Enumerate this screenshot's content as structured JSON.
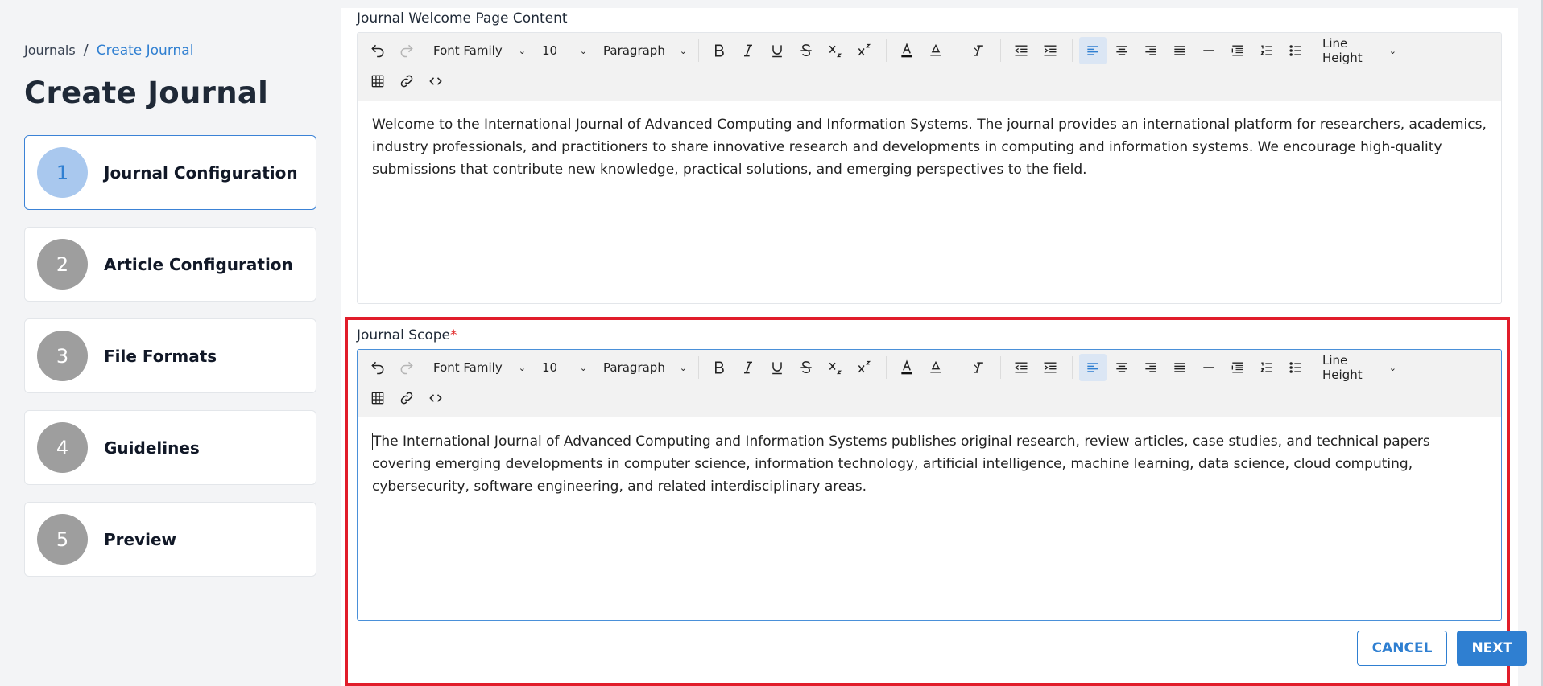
{
  "breadcrumb": {
    "root": "Journals",
    "separator": "/",
    "current": "Create Journal"
  },
  "page_title": "Create Journal",
  "steps": [
    {
      "number": "1",
      "label": "Journal Configuration",
      "active": true
    },
    {
      "number": "2",
      "label": "Article Configuration"
    },
    {
      "number": "3",
      "label": "File Formats"
    },
    {
      "number": "4",
      "label": "Guidelines"
    },
    {
      "number": "5",
      "label": "Preview"
    }
  ],
  "toolbar": {
    "font_family": "Font Family",
    "font_size": "10",
    "block_format": "Paragraph",
    "line_height": "Line Height"
  },
  "welcome": {
    "label": "Journal Welcome Page Content",
    "content": "Welcome to the International Journal of Advanced Computing and Information Systems. The journal provides an international platform for researchers, academics, industry professionals, and practitioners to share innovative research and developments in computing and information systems. We encourage high-quality submissions that contribute new knowledge, practical solutions, and emerging perspectives to the field."
  },
  "scope": {
    "label": "Journal Scope",
    "required_marker": "*",
    "content": "The International Journal of Advanced Computing and Information Systems publishes original research, review articles, case studies, and technical papers covering emerging developments in computer science, information technology, artificial intelligence, machine learning, data science, cloud computing, cybersecurity, software engineering, and related interdisciplinary areas."
  },
  "actions": {
    "cancel": "CANCEL",
    "next": "NEXT"
  },
  "colors": {
    "accent": "#2f7fd1",
    "highlight": "#e11d2a",
    "step_inactive": "#9e9e9e",
    "step_active_bg": "#a9c8ee"
  }
}
